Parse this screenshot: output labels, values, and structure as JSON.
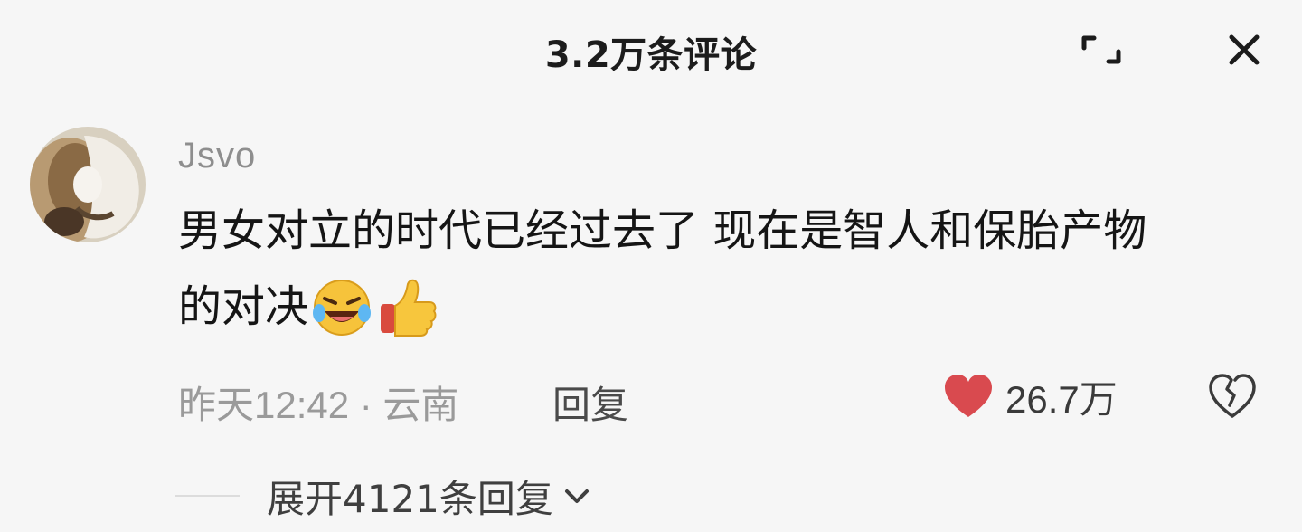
{
  "header": {
    "title": "3.2万条评论",
    "expand_icon": "expand-icon",
    "close_icon": "close-icon"
  },
  "comment": {
    "avatar_icon": "user-avatar",
    "username": "Jsvo",
    "text_line1": "男女对立的时代已经过去了 现在是智人和保胎产物",
    "text_line2": "的对决",
    "emojis": [
      "laughing-crying-emoji",
      "thumbs-up-emoji"
    ],
    "time_location": "昨天12:42 · 云南",
    "reply_label": "回复",
    "like_icon": "heart-icon",
    "like_color": "#d94a4f",
    "like_count": "26.7万",
    "dislike_icon": "broken-heart-icon",
    "expand_replies": "展开4121条回复",
    "expand_icon": "chevron-down-icon"
  }
}
